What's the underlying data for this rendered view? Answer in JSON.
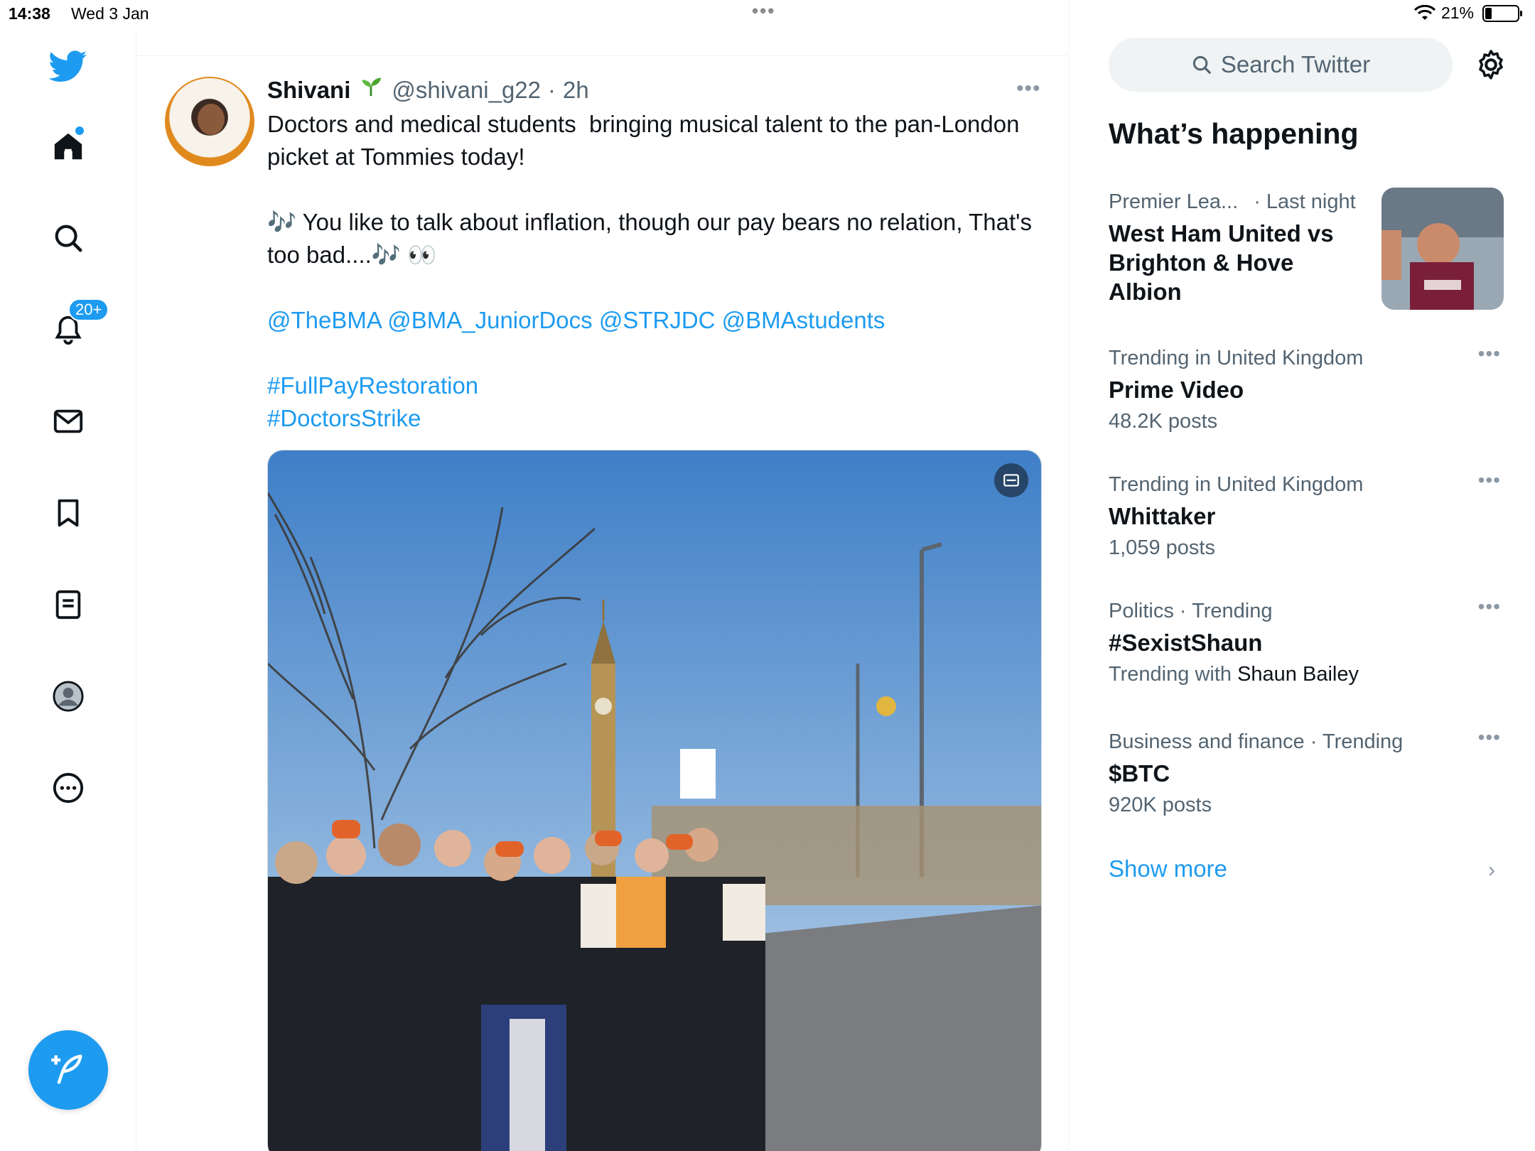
{
  "status_bar": {
    "time": "14:38",
    "date": "Wed 3 Jan",
    "battery": "21%"
  },
  "nav": {
    "notifications_badge": "20+"
  },
  "tweet": {
    "name": "Shivani",
    "handle": "@shivani_g22",
    "separator": "·",
    "time": "2h",
    "line1": "Doctors and medical students  bringing musical talent to the pan-London picket at Tommies today!",
    "line2": "🎶 You like to talk about inflation, though our pay bears no relation, That's too bad....🎶 👀",
    "mentions": "@TheBMA @BMA_JuniorDocs @STRJDC @BMAstudents",
    "hashtag1": "#FullPayRestoration",
    "hashtag2": "#DoctorsStrike"
  },
  "sidebar": {
    "search_placeholder": "Search Twitter",
    "heading": "What’s happening",
    "trends": [
      {
        "category": "Premier Lea...",
        "time": "· Last night",
        "title": "West Ham United vs Brighton & Hove Albion"
      },
      {
        "category": "Trending in United Kingdom",
        "title": "Prime Video",
        "posts": "48.2K posts"
      },
      {
        "category": "Trending in United Kingdom",
        "title": "Whittaker",
        "posts": "1,059 posts"
      },
      {
        "category": "Politics · Trending",
        "title": "#SexistShaun",
        "sub_prefix": "Trending with",
        "sub_strong": "Shaun Bailey"
      },
      {
        "category": "Business and finance · Trending",
        "title": "$BTC",
        "posts": "920K posts"
      }
    ],
    "show_more": "Show more"
  },
  "colors": {
    "accent": "#1d9bf0",
    "text": "#0f1419",
    "secondary": "#536471"
  }
}
